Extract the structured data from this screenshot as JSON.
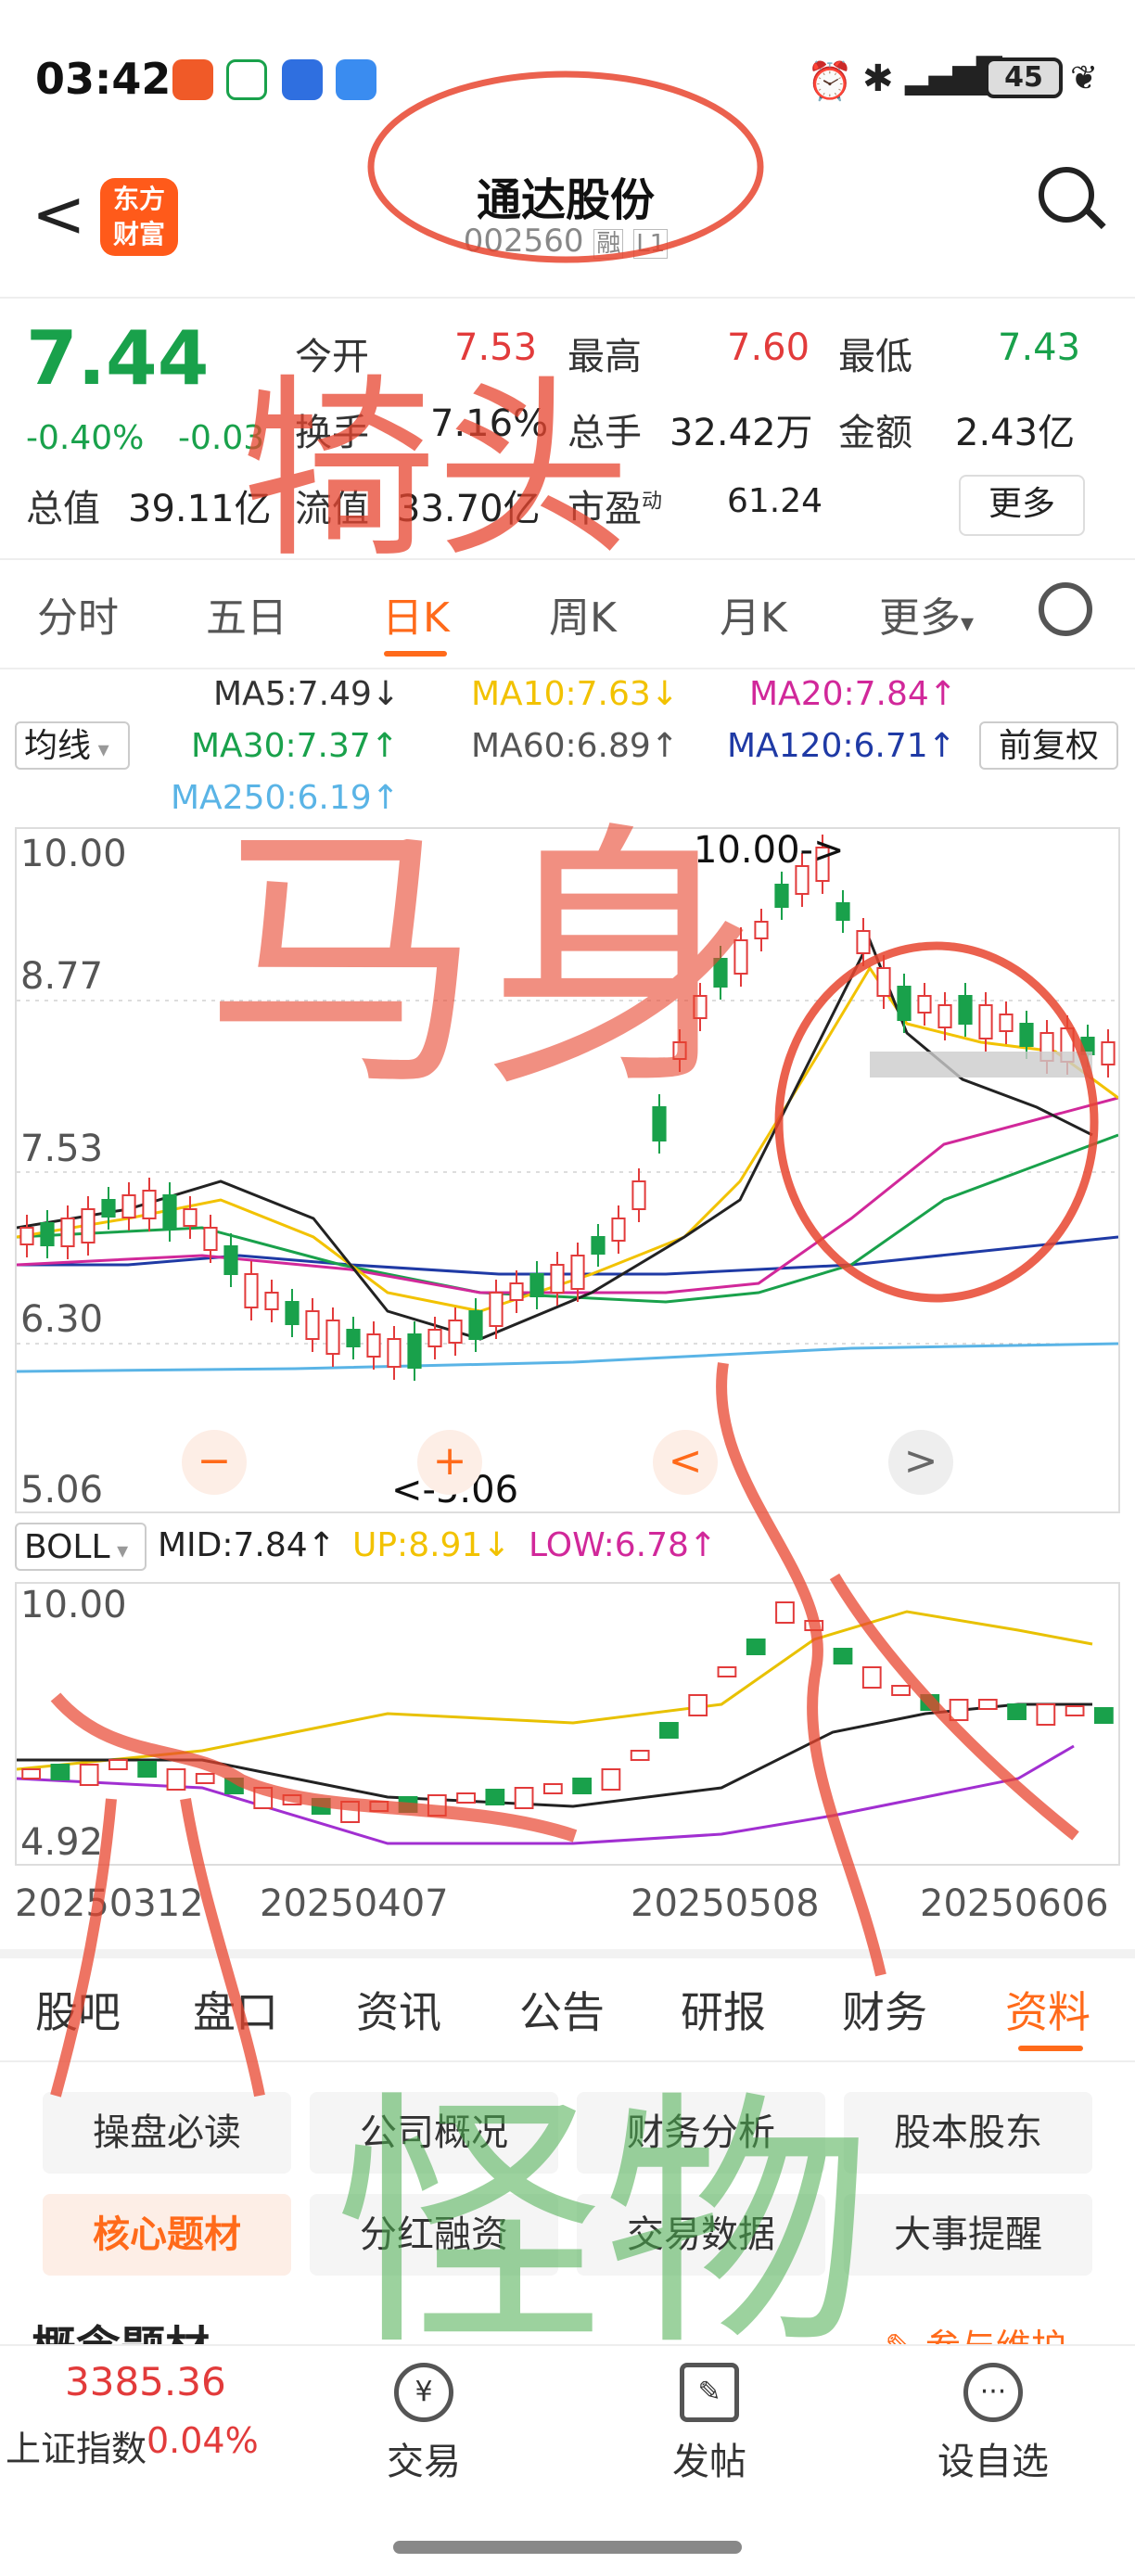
{
  "status": {
    "time": "03:42",
    "battery": "45"
  },
  "header": {
    "back_label": "<",
    "logo_text": "东方\n财富",
    "name": "通达股份",
    "code": "002560",
    "badge_margin": "融",
    "badge_level": "L1"
  },
  "quote": {
    "price": "7.44",
    "change_pct": "-0.40%",
    "change": "-0.03",
    "fields": [
      {
        "label": "今开",
        "value": "7.53"
      },
      {
        "label": "最高",
        "value": "7.60"
      },
      {
        "label": "最低",
        "value": "7.43"
      },
      {
        "label": "换手",
        "value": "7.16%"
      },
      {
        "label": "总手",
        "value": "32.42万"
      },
      {
        "label": "金额",
        "value": "2.43亿"
      },
      {
        "label": "总值",
        "value": "39.11亿"
      },
      {
        "label": "流值",
        "value": "33.70亿"
      },
      {
        "label": "市盈",
        "sup": "动",
        "value": "61.24"
      }
    ],
    "more": "更多"
  },
  "period_tabs": [
    "分时",
    "五日",
    "日K",
    "周K",
    "月K",
    "更多"
  ],
  "ma": {
    "selector": "均线",
    "items": [
      {
        "label": "MA5:7.49↓",
        "color": "#333333"
      },
      {
        "label": "MA10:7.63↓",
        "color": "#f2c200"
      },
      {
        "label": "MA20:7.84↑",
        "color": "#d1289a"
      },
      {
        "label": "MA30:7.37↑",
        "color": "#19a14b"
      },
      {
        "label": "MA60:6.89↑",
        "color": "#555555"
      },
      {
        "label": "MA120:6.71↑",
        "color": "#1f3aa5"
      },
      {
        "label": "MA250:6.19↑",
        "color": "#5ab4e6"
      }
    ],
    "adjust": "前复权"
  },
  "kchart": {
    "yticks": [
      "10.00",
      "8.77",
      "7.53",
      "6.30",
      "5.06"
    ],
    "high_marker": "10.00->",
    "low_marker": "<-5.06",
    "buttons": [
      "−",
      "+",
      "<",
      ">"
    ]
  },
  "boll": {
    "selector": "BOLL",
    "mid": "MID:7.84↑",
    "up": "UP:8.91↓",
    "low": "LOW:6.78↑",
    "yticks": [
      "10.00",
      "4.92"
    ]
  },
  "dates": [
    "20250312",
    "20250407",
    "20250508",
    "20250606"
  ],
  "bottom_tabs": [
    "股吧",
    "盘口",
    "资讯",
    "公告",
    "研报",
    "财务",
    "资料"
  ],
  "chips": [
    "操盘必读",
    "公司概况",
    "财务分析",
    "股本股东",
    "核心题材",
    "分红融资",
    "交易数据",
    "大事提醒"
  ],
  "section_title": "概念题材",
  "section_link": "参与维护",
  "footer": {
    "index_value": "3385.36",
    "index_name": "上证指数",
    "index_pct": "0.04%",
    "trade": "交易",
    "post": "发帖",
    "watch": "设自选"
  },
  "handwriting": [
    "犄头",
    "马身",
    "怪物"
  ]
}
